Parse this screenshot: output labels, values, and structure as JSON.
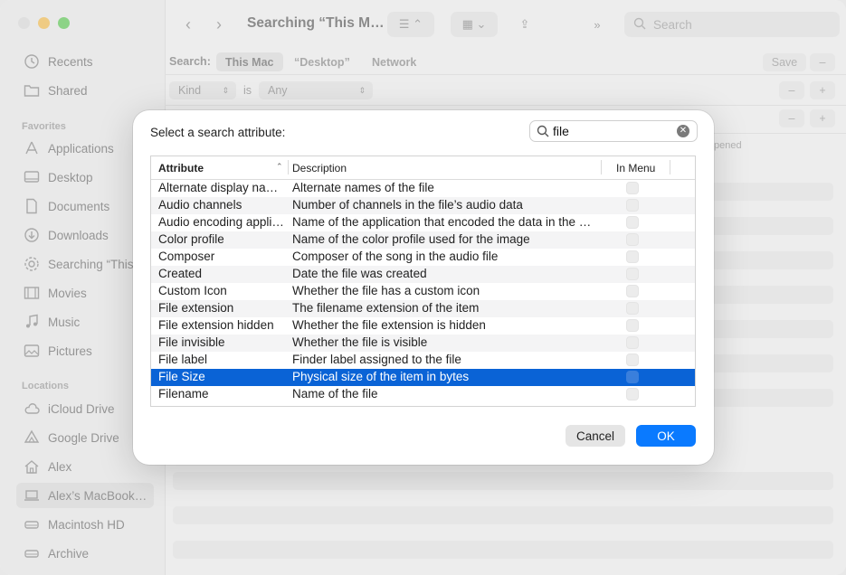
{
  "sidebar": {
    "recents": "Recents",
    "shared": "Shared",
    "favorites_header": "Favorites",
    "applications": "Applications",
    "desktop": "Desktop",
    "documents": "Documents",
    "downloads": "Downloads",
    "searching": "Searching “This…",
    "movies": "Movies",
    "music": "Music",
    "pictures": "Pictures",
    "locations_header": "Locations",
    "icloud": "iCloud Drive",
    "google": "Google Drive",
    "alex": "Alex",
    "macbook": "Alex’s MacBook…",
    "macintosh": "Macintosh HD",
    "archive": "Archive"
  },
  "toolbar": {
    "title": "Searching “This M…",
    "search_placeholder": "Search"
  },
  "scope": {
    "label": "Search:",
    "this_mac": "This Mac",
    "desktop": "“Desktop”",
    "network": "Network",
    "save": "Save",
    "minus": "–"
  },
  "criteria": {
    "kind": "Kind",
    "is": "is",
    "any": "Any",
    "minus": "–",
    "plus": "+",
    "opened_col": "pened"
  },
  "dialog": {
    "title": "Select a search attribute:",
    "search_value": "file",
    "columns": {
      "attribute": "Attribute",
      "description": "Description",
      "in_menu": "In Menu"
    },
    "rows": [
      {
        "attribute": "Alternate display names",
        "description": "Alternate names of the file"
      },
      {
        "attribute": "Audio channels",
        "description": "Number of channels in the file’s audio data"
      },
      {
        "attribute": "Audio encoding application",
        "description": "Name of the application that encoded the data in the audio file"
      },
      {
        "attribute": "Color profile",
        "description": "Name of the color profile used for the image"
      },
      {
        "attribute": "Composer",
        "description": "Composer of the song in the audio file"
      },
      {
        "attribute": "Created",
        "description": "Date the file was created"
      },
      {
        "attribute": "Custom Icon",
        "description": "Whether the file has a custom icon"
      },
      {
        "attribute": "File extension",
        "description": "The filename extension of the item"
      },
      {
        "attribute": "File extension hidden",
        "description": "Whether the file extension is hidden"
      },
      {
        "attribute": "File invisible",
        "description": "Whether the file is visible"
      },
      {
        "attribute": "File label",
        "description": "Finder label assigned to the file"
      },
      {
        "attribute": "File Size",
        "description": "Physical size of the item in bytes"
      },
      {
        "attribute": "Filename",
        "description": "Name of the file"
      }
    ],
    "selected_index": 11,
    "cancel": "Cancel",
    "ok": "OK"
  },
  "colors": {
    "accent": "#0a7aff",
    "selection": "#0a63d6"
  }
}
